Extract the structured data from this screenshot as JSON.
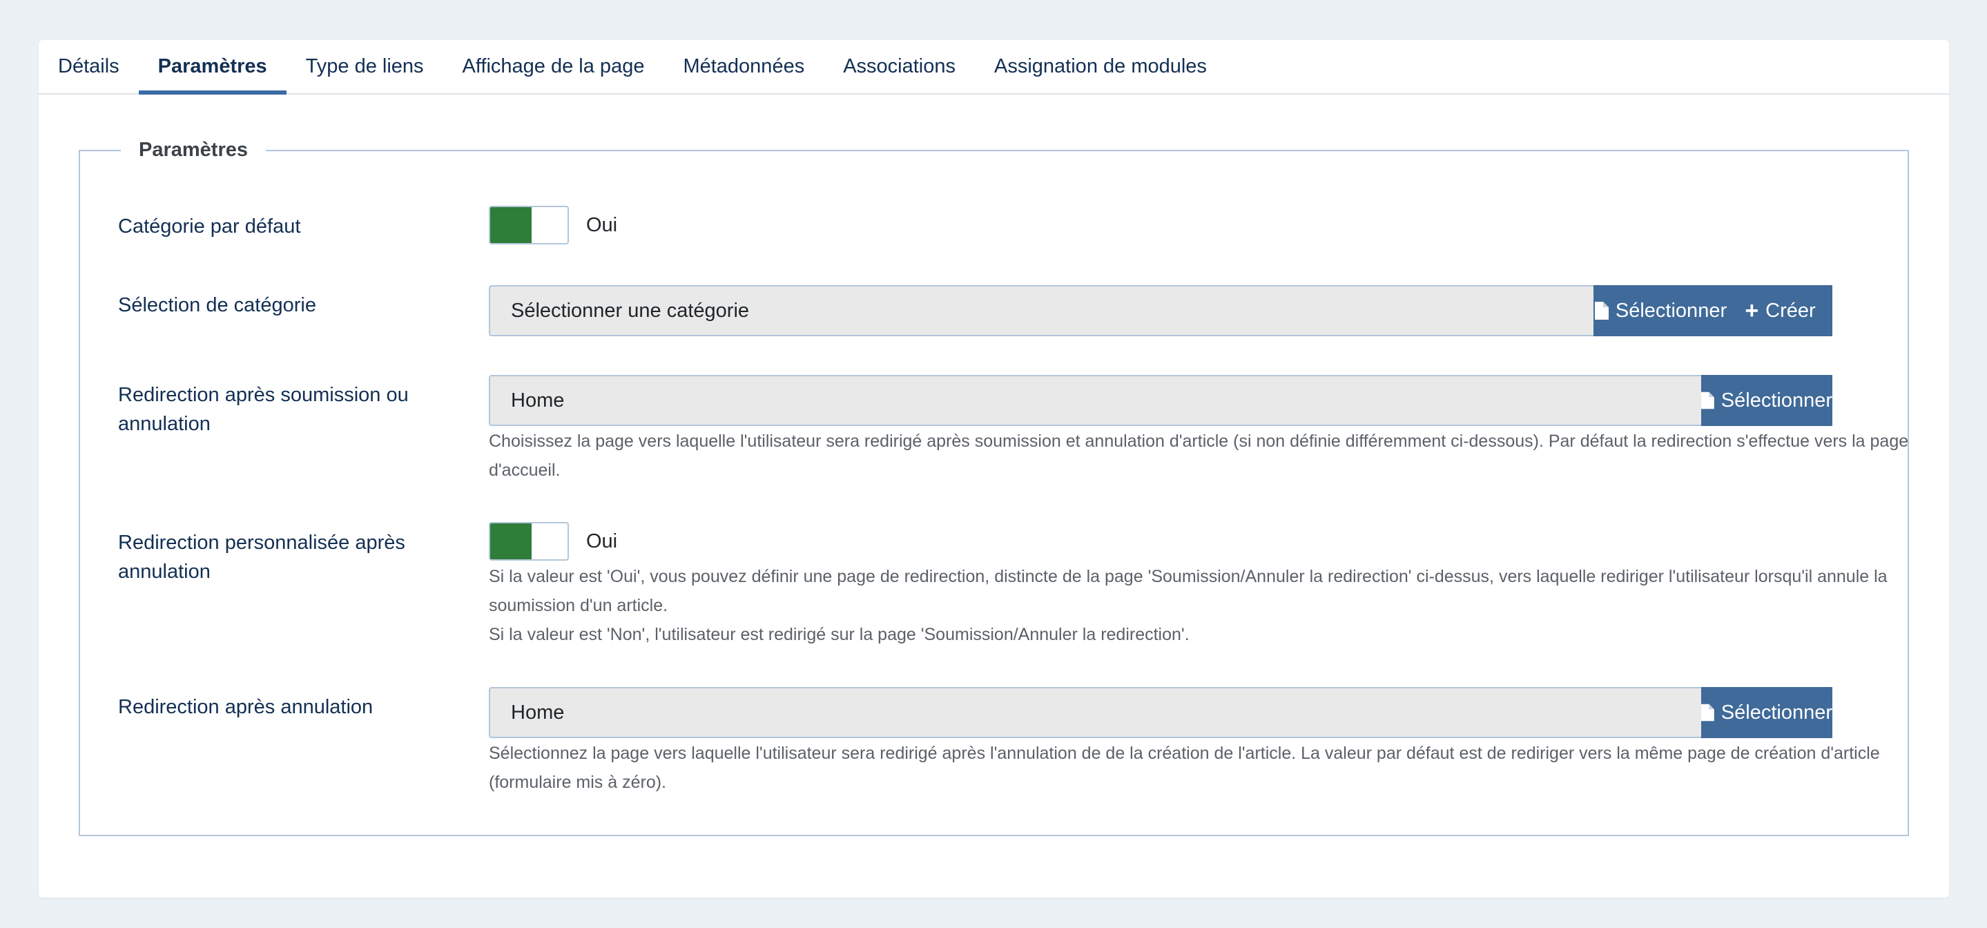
{
  "tabs": [
    {
      "label": "Détails"
    },
    {
      "label": "Paramètres"
    },
    {
      "label": "Type de liens"
    },
    {
      "label": "Affichage de la page"
    },
    {
      "label": "Métadonnées"
    },
    {
      "label": "Associations"
    },
    {
      "label": "Assignation de modules"
    }
  ],
  "fieldset": {
    "legend": "Paramètres"
  },
  "fields": {
    "default_category": {
      "label": "Catégorie par défaut",
      "value": "Oui"
    },
    "category_select": {
      "label": "Sélection de catégorie",
      "value": "Sélectionner une catégorie",
      "select_label": "Sélectionner",
      "create_label": "Créer"
    },
    "redirect_submit": {
      "label_line1": "Redirection après soumission ou",
      "label_line2": "annulation",
      "value": "Home",
      "select_label": "Sélectionner",
      "help_line1": "Choisissez la page vers laquelle l'utilisateur sera redirigé après soumission et annulation d'article (si non définie différemment ci-dessous). Par défaut la redirection s'effectue vers la page",
      "help_line2": "d'accueil."
    },
    "custom_redirect": {
      "label_line1": "Redirection personnalisée après",
      "label_line2": "annulation",
      "value": "Oui",
      "help_line1": "Si la valeur est 'Oui', vous pouvez définir une page de redirection, distincte de la page 'Soumission/Annuler la redirection' ci-dessus, vers laquelle rediriger l'utilisateur lorsqu'il annule la",
      "help_line2": "soumission d'un article.",
      "help_line3": "Si la valeur est 'Non', l'utilisateur est redirigé sur la page 'Soumission/Annuler la redirection'."
    },
    "redirect_cancel": {
      "label": "Redirection après annulation",
      "value": "Home",
      "select_label": "Sélectionner",
      "help_line1": "Sélectionnez la page vers laquelle l'utilisateur sera redirigé après l'annulation de de la création de l'article. La valeur par défaut est de rediriger vers la même page de création d'article",
      "help_line2": "(formulaire mis à zéro)."
    }
  },
  "icons": {
    "select": "file-icon",
    "create": "plus-icon"
  },
  "colors": {
    "accent": "#3a6ba5",
    "button": "#3f6a99",
    "toggle_on": "#2e7d39",
    "background": "#ecf1f5"
  }
}
